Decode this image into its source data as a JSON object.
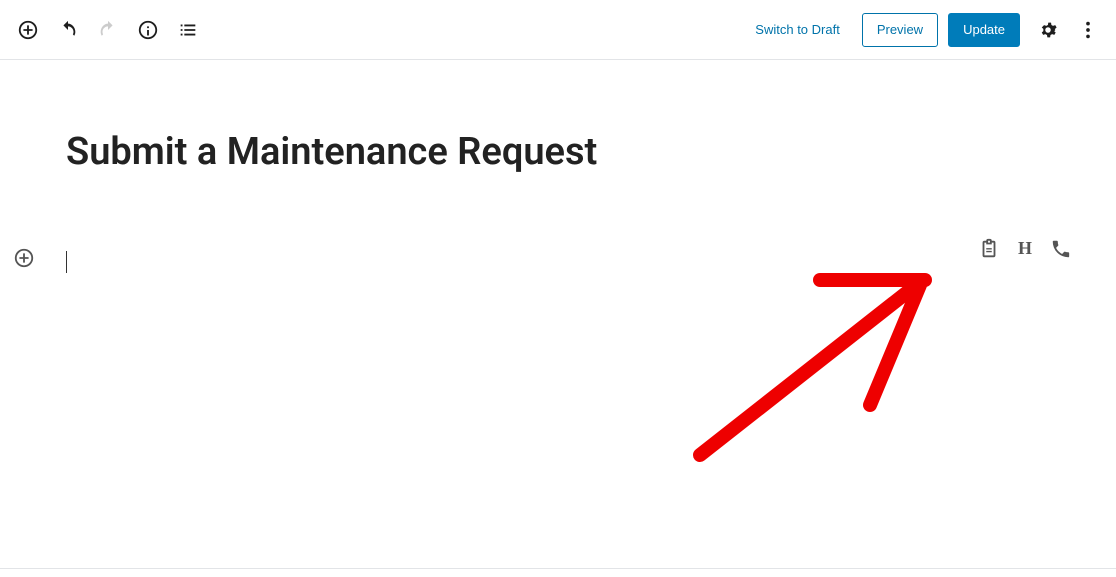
{
  "toolbar": {
    "switch_draft": "Switch to Draft",
    "preview": "Preview",
    "update": "Update"
  },
  "page": {
    "title": "Submit a Maintenance Request"
  },
  "block_suggestions": {
    "h_label": "H"
  }
}
